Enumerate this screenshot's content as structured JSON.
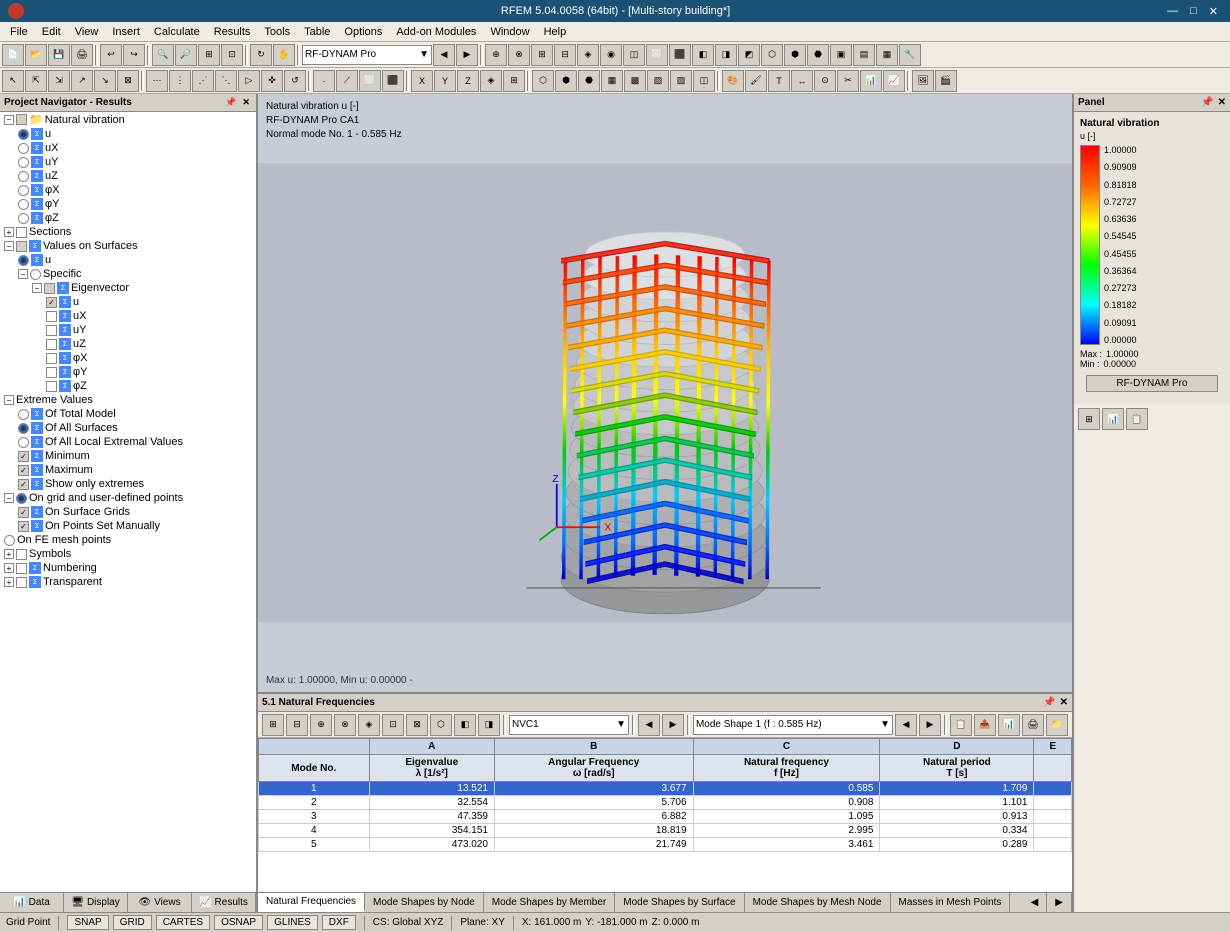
{
  "titlebar": {
    "title": "RFEM 5.04.0058 (64bit) - [Multi-story building*]",
    "min": "—",
    "max": "□",
    "close": "✕"
  },
  "menubar": {
    "items": [
      "File",
      "Edit",
      "View",
      "Insert",
      "Calculate",
      "Results",
      "Tools",
      "Table",
      "Options",
      "Add-on Modules",
      "Window",
      "Help"
    ]
  },
  "toolbar1": {
    "dropdown": "RF-DYNAM Pro"
  },
  "leftpanel": {
    "title": "Project Navigator - Results",
    "tree": {
      "root": "Natural vibration",
      "items": [
        {
          "label": "u",
          "level": 2,
          "type": "radio",
          "selected": true
        },
        {
          "label": "uX",
          "level": 2,
          "type": "radio"
        },
        {
          "label": "uY",
          "level": 2,
          "type": "radio"
        },
        {
          "label": "uZ",
          "level": 2,
          "type": "radio"
        },
        {
          "label": "φX",
          "level": 2,
          "type": "radio"
        },
        {
          "label": "φY",
          "level": 2,
          "type": "radio"
        },
        {
          "label": "φZ",
          "level": 2,
          "type": "radio"
        },
        {
          "label": "Sections",
          "level": 1,
          "type": "check"
        },
        {
          "label": "Values on Surfaces",
          "level": 1,
          "type": "check",
          "expanded": true
        },
        {
          "label": "u",
          "level": 2,
          "type": "radio",
          "selected": true
        },
        {
          "label": "Specific",
          "level": 2,
          "type": "folder",
          "expanded": true
        },
        {
          "label": "Eigenvector",
          "level": 3,
          "type": "folder",
          "expanded": true
        },
        {
          "label": "u",
          "level": 4,
          "type": "check",
          "checked": true
        },
        {
          "label": "uX",
          "level": 4,
          "type": "check"
        },
        {
          "label": "uY",
          "level": 4,
          "type": "check"
        },
        {
          "label": "uZ",
          "level": 4,
          "type": "check"
        },
        {
          "label": "φX",
          "level": 4,
          "type": "check"
        },
        {
          "label": "φY",
          "level": 4,
          "type": "check"
        },
        {
          "label": "φZ",
          "level": 4,
          "type": "check"
        },
        {
          "label": "Extreme Values",
          "level": 1,
          "type": "folder",
          "expanded": true
        },
        {
          "label": "Of Total Model",
          "level": 2,
          "type": "radio"
        },
        {
          "label": "Of All Surfaces",
          "level": 2,
          "type": "radio",
          "selected": true
        },
        {
          "label": "Of All Local Extremal Values",
          "level": 2,
          "type": "radio"
        },
        {
          "label": "Minimum",
          "level": 2,
          "type": "check",
          "checked": true
        },
        {
          "label": "Maximum",
          "level": 2,
          "type": "check",
          "checked": true
        },
        {
          "label": "Show only extremes",
          "level": 2,
          "type": "check",
          "checked": true
        },
        {
          "label": "On grid and user-defined points",
          "level": 1,
          "type": "radio",
          "selected": true
        },
        {
          "label": "On Surface Grids",
          "level": 2,
          "type": "check",
          "checked": true
        },
        {
          "label": "On Points Set Manually",
          "level": 2,
          "type": "check",
          "checked": true
        },
        {
          "label": "On FE mesh points",
          "level": 1,
          "type": "radio"
        },
        {
          "label": "Symbols",
          "level": 1,
          "type": "check"
        },
        {
          "label": "Numbering",
          "level": 1,
          "type": "check"
        },
        {
          "label": "Transparent",
          "level": 1,
          "type": "check"
        }
      ]
    }
  },
  "view3d": {
    "label1": "Natural vibration u [-]",
    "label2": "RF-DYNAM Pro CA1",
    "label3": "Normal mode No. 1 - 0.585 Hz",
    "bottom_label": "Max u: 1.00000, Min u: 0.00000 -"
  },
  "rightpanel": {
    "title": "Panel",
    "legend_title": "Natural vibration",
    "legend_subtitle": "u [-]",
    "values": [
      "1.00000",
      "0.90909",
      "0.81818",
      "0.72727",
      "0.63636",
      "0.54545",
      "0.45455",
      "0.36364",
      "0.27273",
      "0.18182",
      "0.09091",
      "0.00000"
    ],
    "max_label": "Max :",
    "max_value": "1.00000",
    "min_label": "Min :",
    "min_value": "0.00000",
    "rf_dynam_btn": "RF-DYNAM Pro"
  },
  "bottompanel": {
    "title": "5.1 Natural Frequencies",
    "toolbar_dropdown": "NVC1",
    "mode_shape_dropdown": "Mode Shape 1 (f : 0.585 Hz)",
    "columns": [
      {
        "letter": "A",
        "label": "Mode No."
      },
      {
        "letter": "B",
        "label": "Eigenvalue\nλ [1/s²]"
      },
      {
        "letter": "C",
        "label": "Angular Frequency\nω [rad/s]"
      },
      {
        "letter": "D",
        "label": "Natural frequency\nf [Hz]"
      },
      {
        "letter": "E",
        "label": "Natural period\nT [s]"
      }
    ],
    "rows": [
      {
        "mode": "1",
        "eigenvalue": "13.521",
        "angular": "3.677",
        "natural_freq": "0.585",
        "period": "1.709",
        "selected": true
      },
      {
        "mode": "2",
        "eigenvalue": "32.554",
        "angular": "5.706",
        "natural_freq": "0.908",
        "period": "1.101"
      },
      {
        "mode": "3",
        "eigenvalue": "47.359",
        "angular": "6.882",
        "natural_freq": "1.095",
        "period": "0.913"
      },
      {
        "mode": "4",
        "eigenvalue": "354.151",
        "angular": "18.819",
        "natural_freq": "2.995",
        "period": "0.334"
      },
      {
        "mode": "5",
        "eigenvalue": "473.020",
        "angular": "21.749",
        "natural_freq": "3.461",
        "period": "0.289"
      }
    ],
    "tabs": [
      "Natural Frequencies",
      "Mode Shapes by Node",
      "Mode Shapes by Member",
      "Mode Shapes by Surface",
      "Mode Shapes by Mesh Node",
      "Masses in Mesh Points"
    ]
  },
  "navtabs": {
    "items": [
      "Data",
      "Display",
      "Views",
      "Results"
    ]
  },
  "statusbar": {
    "left": "Grid Point",
    "snap": "SNAP",
    "grid": "GRID",
    "cartes": "CARTES",
    "osnap": "OSNAP",
    "glines": "GLINES",
    "dxf": "DXF",
    "cs": "CS: Global XYZ",
    "plane": "Plane: XY",
    "x": "X: 161.000 m",
    "y": "Y: -181.000 m",
    "z": "Z: 0.000 m"
  }
}
